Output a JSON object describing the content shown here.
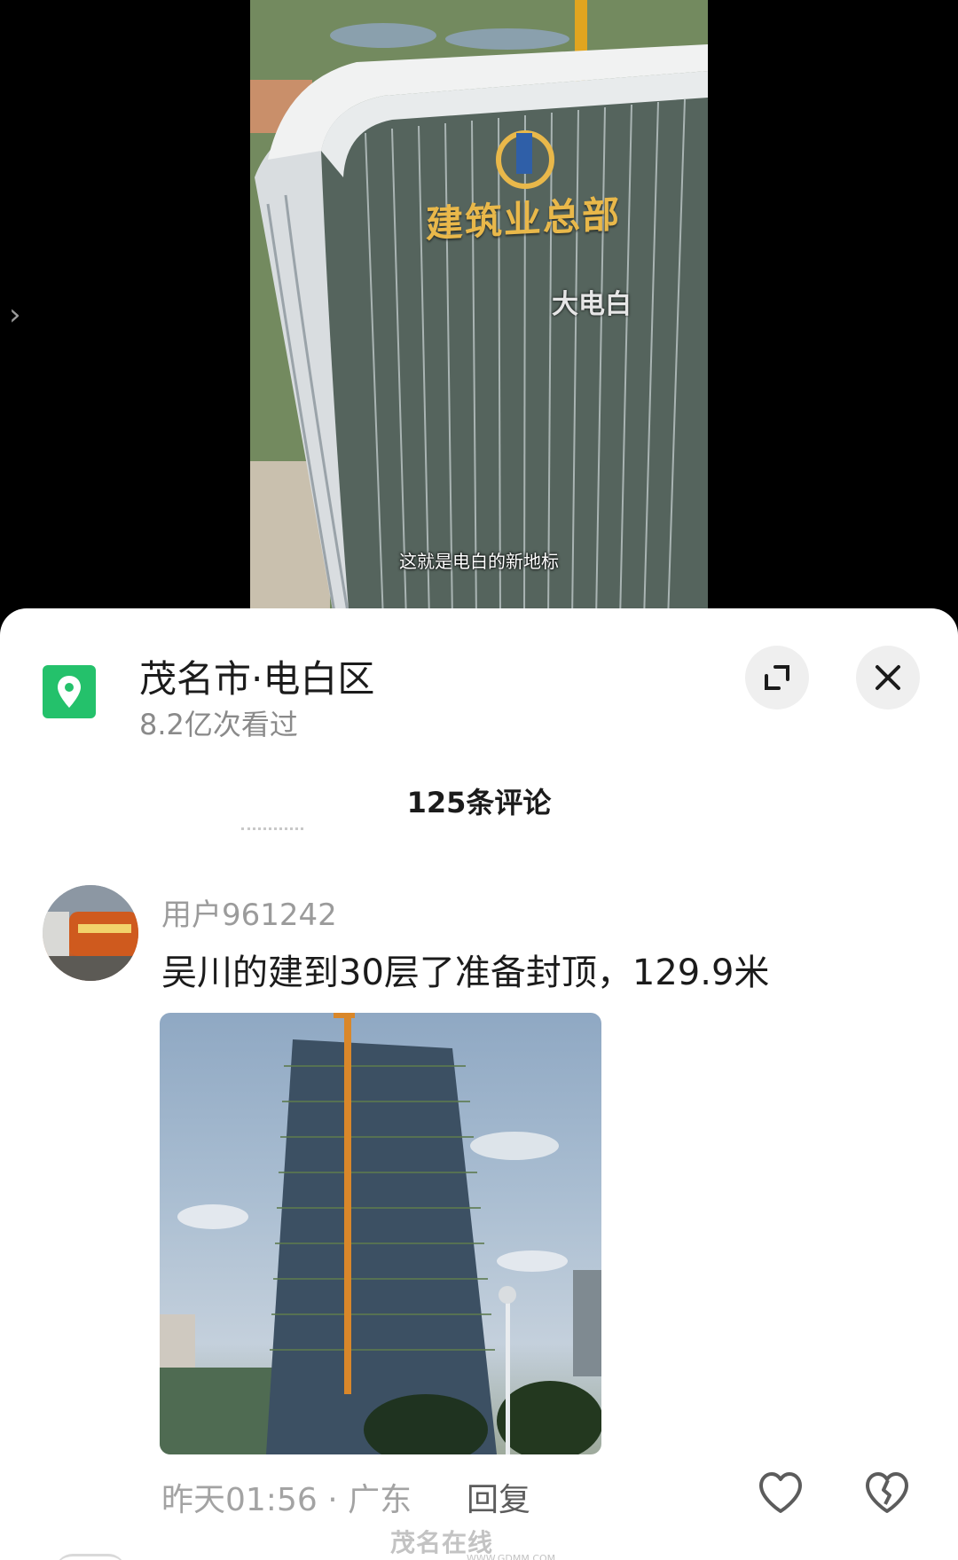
{
  "video": {
    "building_sign": "建筑业总部",
    "overlay_label": "大电白",
    "subtitle": "这就是电白的新地标"
  },
  "location": {
    "title": "茂名市·电白区",
    "views": "8.2亿次看过",
    "pin_color": "#24c16b"
  },
  "actions": {
    "expand_icon": "expand-icon",
    "close_icon": "close-icon"
  },
  "comments": {
    "count_label": "125条评论",
    "items": [
      {
        "username": "用户961242",
        "text": "吴川的建到30层了准备封顶，129.9米",
        "time_location": "昨天01:56 · 广东",
        "reply_label": "回复"
      }
    ]
  },
  "watermark": {
    "site_name": "茂名在线",
    "site_url": "WWW.GDMM.COM"
  }
}
